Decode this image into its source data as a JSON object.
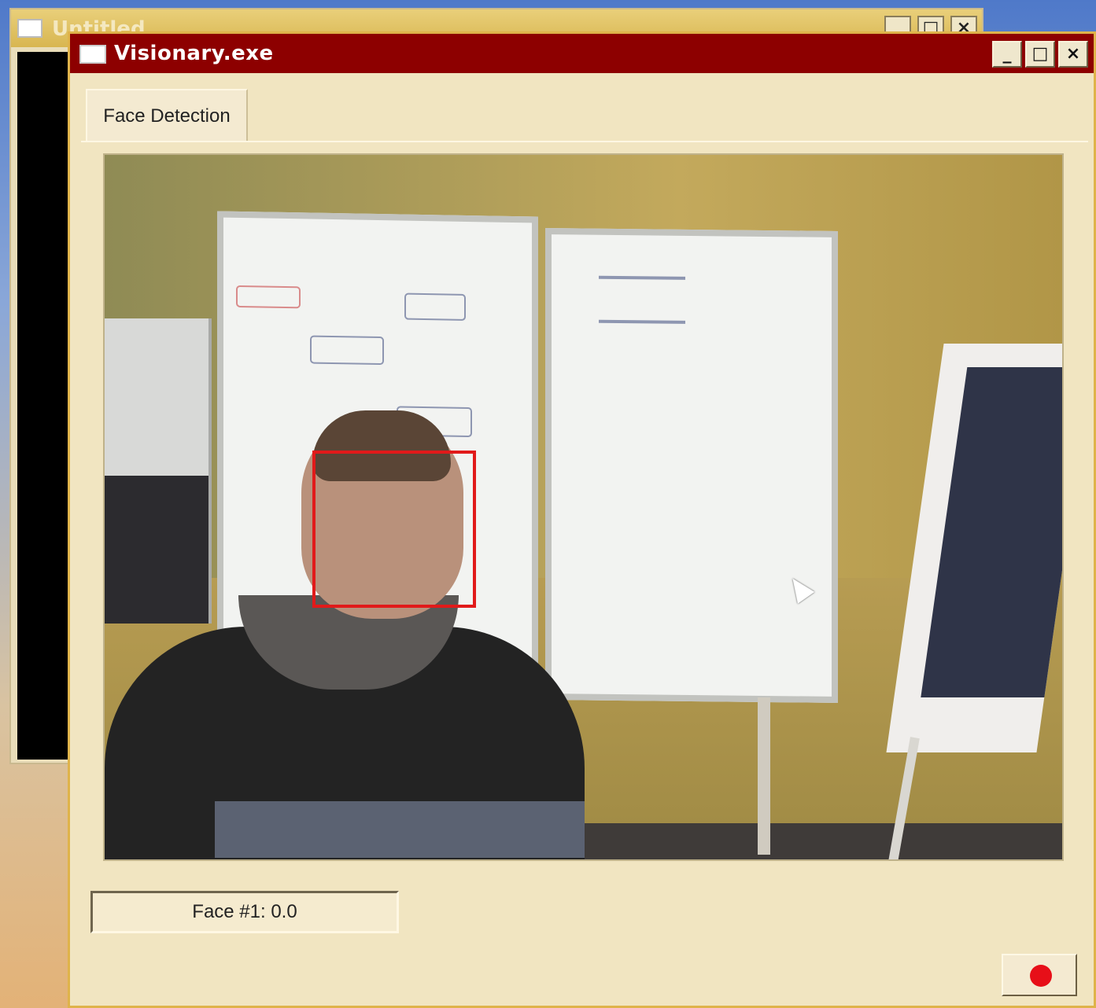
{
  "background_window": {
    "title": "Untitled",
    "controls": [
      "",
      "□",
      "×"
    ]
  },
  "window": {
    "title": "Visionary.exe",
    "controls": [
      "_",
      "□",
      "×"
    ]
  },
  "tabs": [
    {
      "label": "Face Detection"
    }
  ],
  "status": {
    "face_text": "Face #1:   0.0"
  },
  "record": {
    "icon": "record-dot-icon",
    "color": "#e70f18"
  }
}
